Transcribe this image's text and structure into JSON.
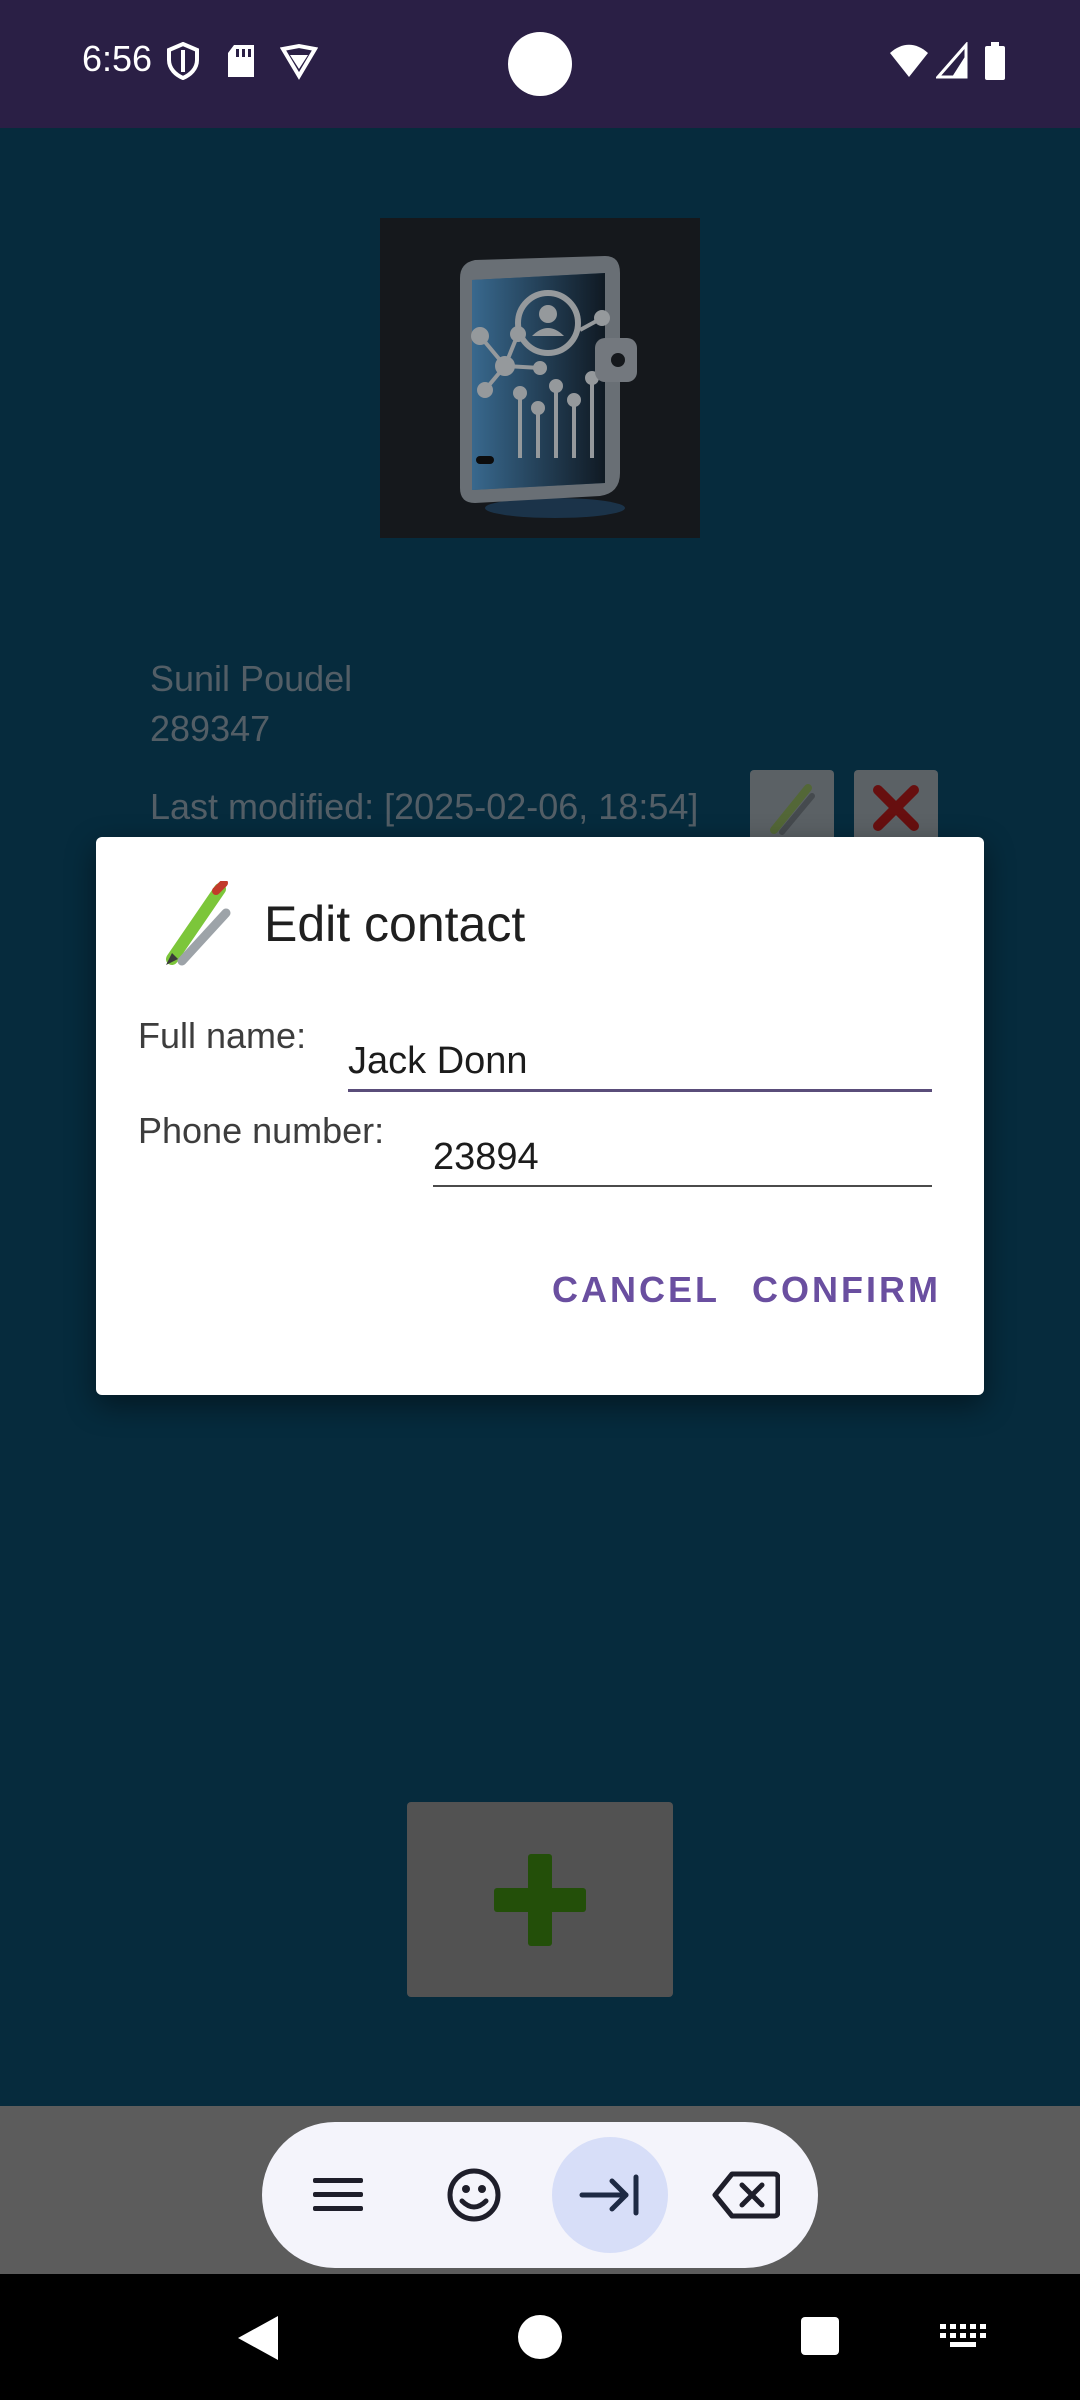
{
  "status_bar": {
    "time": "6:56",
    "icons_left": [
      "shield-icon",
      "sd-card-icon",
      "vpn-icon"
    ],
    "icons_right": [
      "wifi-icon",
      "signal-icon",
      "battery-icon"
    ]
  },
  "contact": {
    "name": "Sunil Poudel",
    "phone": "289347",
    "last_modified": "Last modified: [2025-02-06, 18:54]"
  },
  "dialog": {
    "title": "Edit contact",
    "full_name_label": "Full name:",
    "full_name_value": "Jack Donn",
    "phone_label": "Phone number:",
    "phone_value": "23894",
    "cancel_label": "CANCEL",
    "confirm_label": "CONFIRM"
  },
  "keyboard_toolbar": [
    "menu-icon",
    "emoji-icon",
    "tab-icon",
    "backspace-icon"
  ],
  "nav_bar": [
    "back-icon",
    "home-icon",
    "recents-icon",
    "keyboard-icon"
  ],
  "colors": {
    "status_bar": "#2a1f45",
    "app_background": "#083a52",
    "accent": "#6a4fa0"
  }
}
